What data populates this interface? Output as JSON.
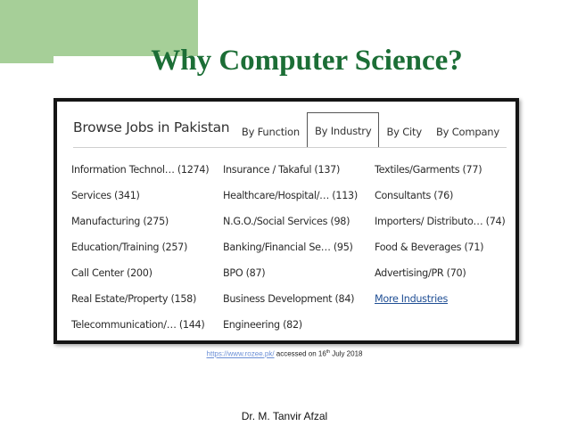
{
  "slide": {
    "title": "Why Computer Science?",
    "footer": "Dr. M. Tanvir Afzal",
    "source": {
      "url": "https://www.rozee.pk/",
      "text_before_sup": "accessed on 16",
      "sup": "th",
      "text_after_sup": " July 2018"
    },
    "accent_color": "#a6cf98",
    "title_color": "#1c6e36"
  },
  "jobs": {
    "heading": "Browse Jobs in Pakistan",
    "tabs": [
      {
        "label": "By Function",
        "active": false
      },
      {
        "label": "By Industry",
        "active": true
      },
      {
        "label": "By City",
        "active": false
      },
      {
        "label": "By Company",
        "active": false
      }
    ],
    "rows": [
      [
        "Information Technol… (1274)",
        "Insurance / Takaful (137)",
        "Textiles/Garments (77)"
      ],
      [
        "Services (341)",
        "Healthcare/Hospital/… (113)",
        "Consultants (76)"
      ],
      [
        "Manufacturing (275)",
        "N.G.O./Social Services (98)",
        "Importers/ Distributo… (74)"
      ],
      [
        "Education/Training (257)",
        "Banking/Financial Se… (95)",
        "Food & Beverages (71)"
      ],
      [
        "Call Center (200)",
        "BPO (87)",
        "Advertising/PR (70)"
      ],
      [
        "Real Estate/Property (158)",
        "Business Development (84)",
        "More Industries"
      ],
      [
        "Telecommunication/… (144)",
        "Engineering (82)",
        ""
      ]
    ],
    "link_color": "#1f4e94"
  }
}
